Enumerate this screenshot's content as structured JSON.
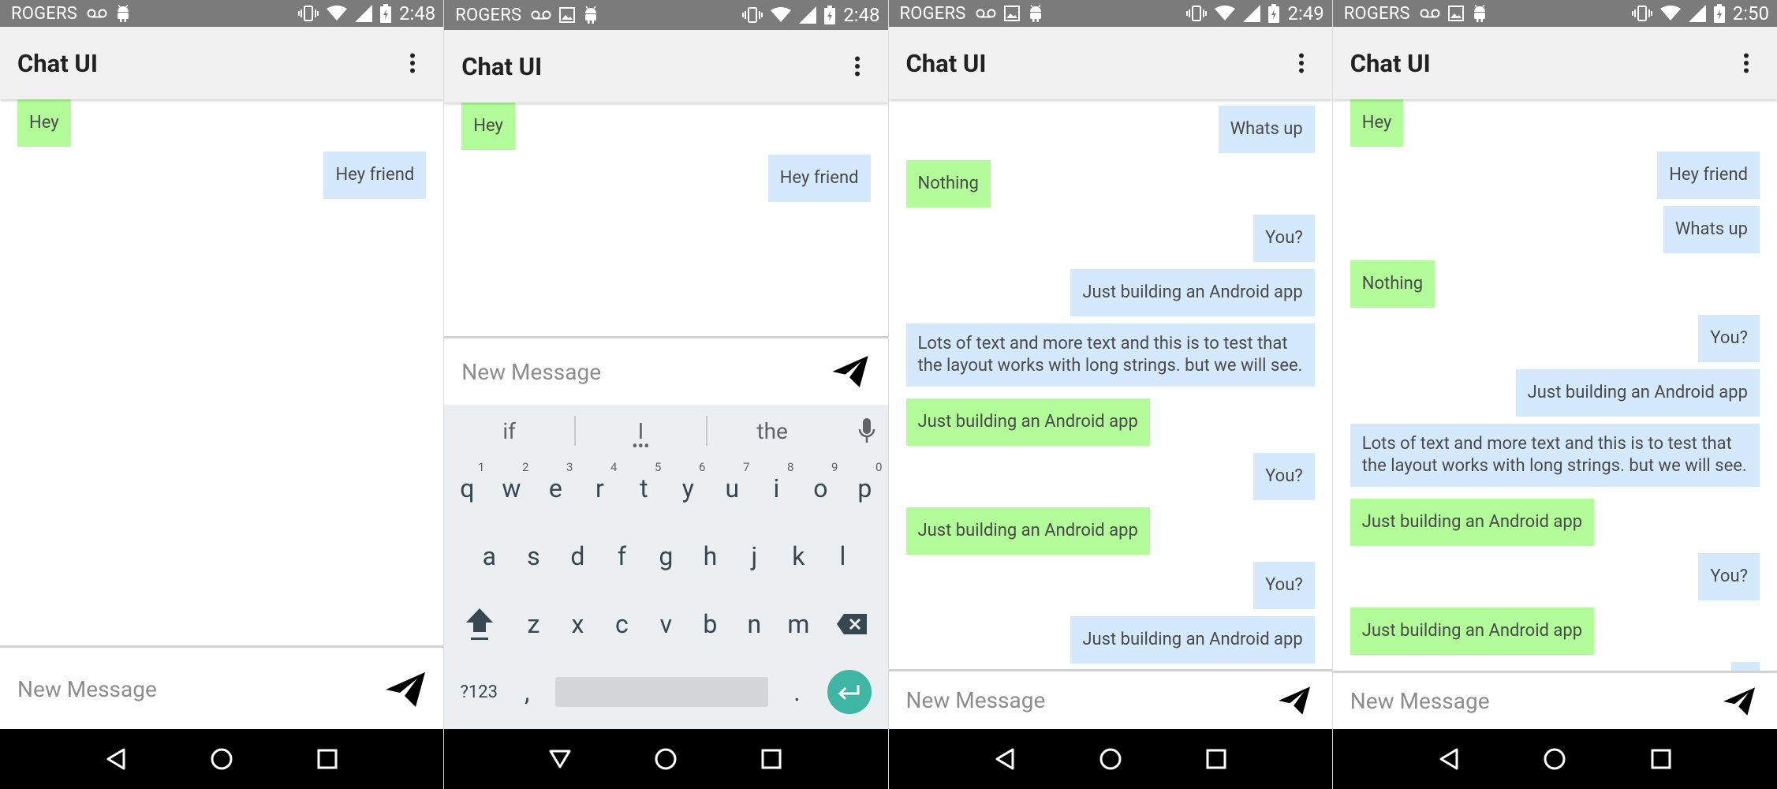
{
  "screens": [
    {
      "status": {
        "carrier": "ROGERS",
        "time": "2:48"
      },
      "app_title": "Chat UI",
      "messages": [
        {
          "side": "left",
          "text": "Hey"
        },
        {
          "side": "right",
          "text": "Hey friend"
        }
      ],
      "input_placeholder": "New Message"
    },
    {
      "status": {
        "carrier": "ROGERS",
        "time": "2:48"
      },
      "app_title": "Chat UI",
      "messages": [
        {
          "side": "left",
          "text": "Hey"
        },
        {
          "side": "right",
          "text": "Hey friend"
        }
      ],
      "input_placeholder": "New Message",
      "keyboard": {
        "suggestions": [
          "if",
          "I",
          "the"
        ],
        "row1": [
          {
            "key": "q",
            "hint": "1"
          },
          {
            "key": "w",
            "hint": "2"
          },
          {
            "key": "e",
            "hint": "3"
          },
          {
            "key": "r",
            "hint": "4"
          },
          {
            "key": "t",
            "hint": "5"
          },
          {
            "key": "y",
            "hint": "6"
          },
          {
            "key": "u",
            "hint": "7"
          },
          {
            "key": "i",
            "hint": "8"
          },
          {
            "key": "o",
            "hint": "9"
          },
          {
            "key": "p",
            "hint": "0"
          }
        ],
        "row2": [
          "a",
          "s",
          "d",
          "f",
          "g",
          "h",
          "j",
          "k",
          "l"
        ],
        "row3": [
          "z",
          "x",
          "c",
          "v",
          "b",
          "n",
          "m"
        ],
        "symbols_label": "?123",
        "comma_label": ",",
        "period_label": "."
      }
    },
    {
      "status": {
        "carrier": "ROGERS",
        "time": "2:49"
      },
      "app_title": "Chat UI",
      "messages": [
        {
          "side": "right",
          "text": "Whats up"
        },
        {
          "side": "left",
          "text": "Nothing"
        },
        {
          "side": "right",
          "text": "You?"
        },
        {
          "side": "right",
          "text": "Just building an Android app"
        },
        {
          "side": "right",
          "text_lines": [
            "Lots of text and more text and this is to test that",
            "the layout works with long strings. but we will see."
          ]
        },
        {
          "side": "left",
          "text": "Just building an Android app"
        },
        {
          "side": "right",
          "text": "You?"
        },
        {
          "side": "left",
          "text": "Just building an Android app"
        },
        {
          "side": "right",
          "text": "You?"
        },
        {
          "side": "right",
          "text": "Just building an Android app"
        }
      ],
      "input_placeholder": "New Message"
    },
    {
      "status": {
        "carrier": "ROGERS",
        "time": "2:50"
      },
      "app_title": "Chat UI",
      "messages": [
        {
          "side": "left",
          "text": "Hey"
        },
        {
          "side": "right",
          "text": "Hey friend"
        },
        {
          "side": "right",
          "text": "Whats up"
        },
        {
          "side": "left",
          "text": "Nothing"
        },
        {
          "side": "right",
          "text": "You?"
        },
        {
          "side": "right",
          "text": "Just building an Android app"
        },
        {
          "side": "right",
          "text_lines": [
            "Lots of text and more text and this is to test that",
            "the layout works with long strings. but we will see."
          ]
        },
        {
          "side": "left",
          "text": "Just building an Android app"
        },
        {
          "side": "right",
          "text": "You?"
        },
        {
          "side": "left",
          "text": "Just building an Android app"
        }
      ],
      "input_placeholder": "New Message"
    }
  ],
  "colors": {
    "status_bar": "#7b7b7b",
    "app_bar": "#f1f1f1",
    "incoming_bubble": "#b2fc9a",
    "outgoing_bubble": "#d4eafc",
    "nav_bar": "#000000",
    "enter_key": "#3fb5a4"
  },
  "icons": [
    "voicemail-icon",
    "android-icon",
    "image-icon",
    "vibrate-icon",
    "wifi-icon",
    "signal-icon",
    "battery-icon",
    "overflow-menu-icon",
    "send-icon",
    "back-icon",
    "home-icon",
    "recents-icon",
    "keyboard-hide-icon",
    "mic-icon",
    "shift-icon",
    "backspace-icon",
    "enter-icon"
  ]
}
